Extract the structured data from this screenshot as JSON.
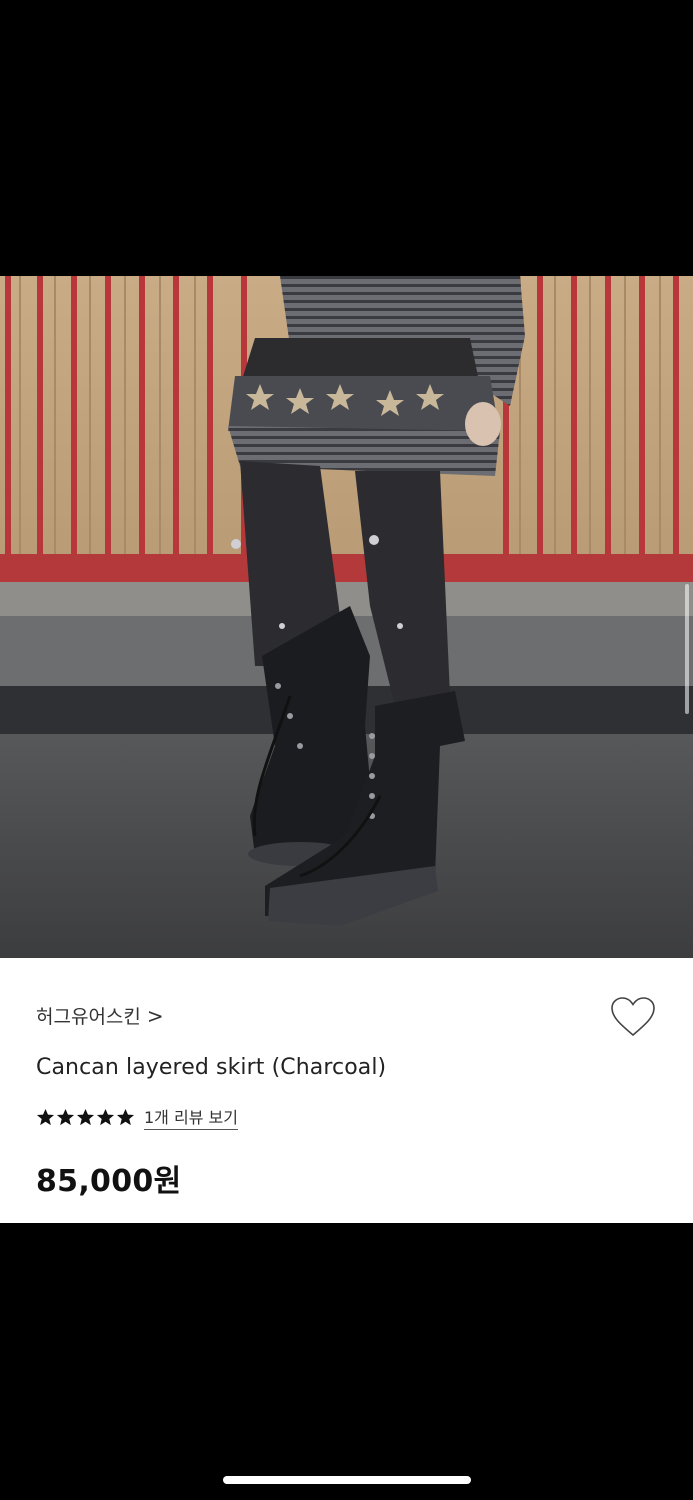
{
  "product": {
    "brand": "허그유어스킨",
    "brand_chevron": ">",
    "name": "Cancan layered skirt (Charcoal)",
    "rating": 5,
    "review_link": "1개 리뷰 보기",
    "price": "85,000원"
  },
  "icons": {
    "wishlist": "heart-outline-icon",
    "rating": "star-icon",
    "brand_link": "chevron-right-icon"
  },
  "colors": {
    "panel_bg": "#ffffff",
    "text_primary": "#111111",
    "fence_red": "#b8373a",
    "page_bg": "#000000"
  }
}
